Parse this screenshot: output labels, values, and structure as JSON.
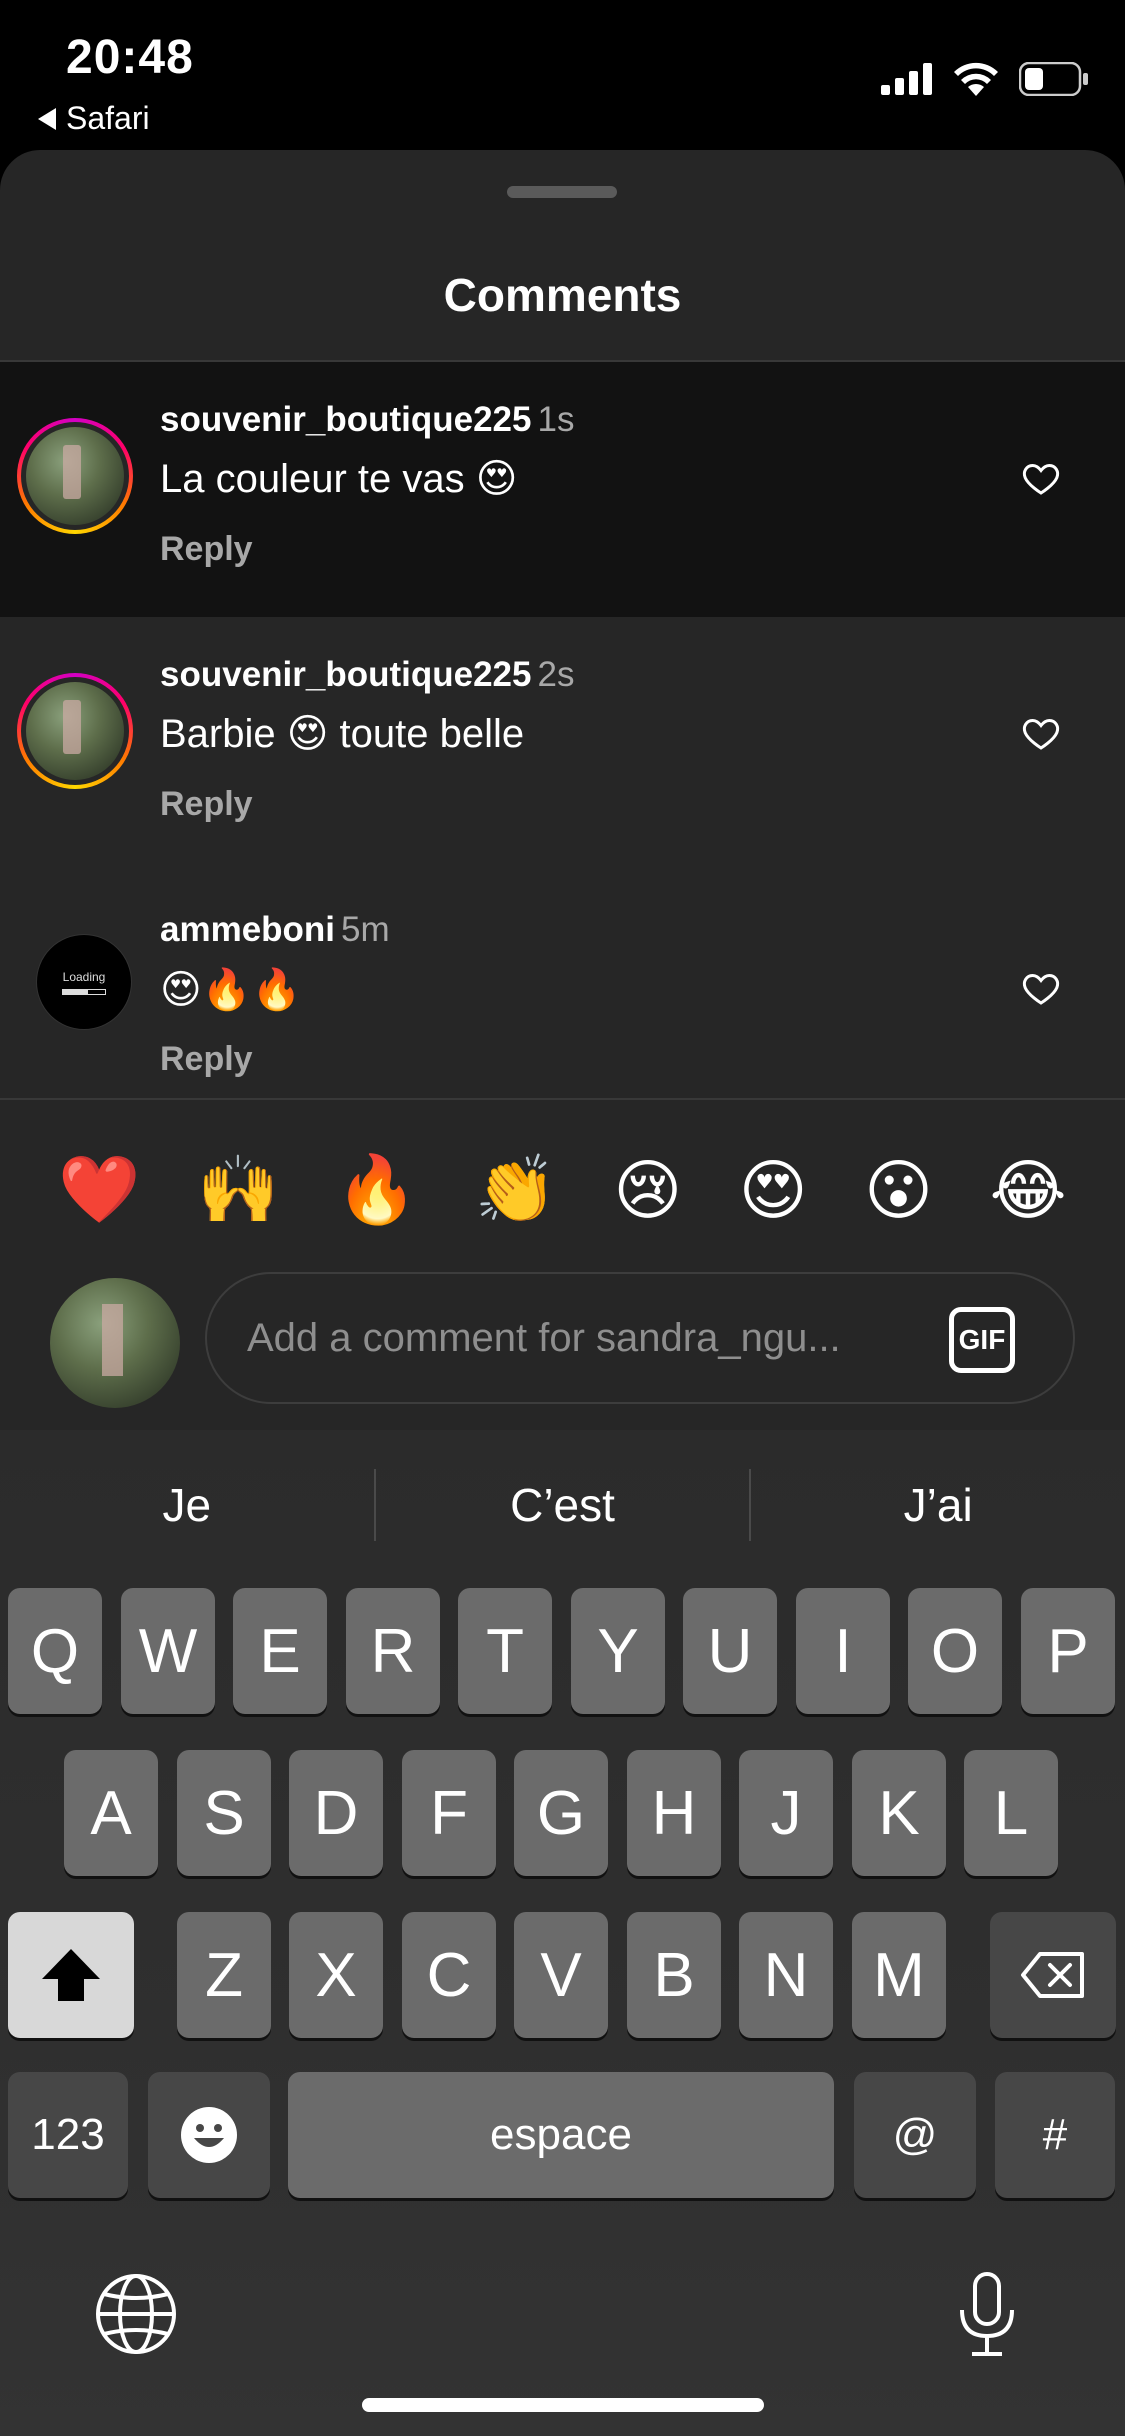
{
  "status_bar": {
    "time": "20:48",
    "back_label": "Safari"
  },
  "sheet": {
    "title": "Comments"
  },
  "comments": [
    {
      "user": "souvenir_boutique225",
      "time": "1s",
      "text": "La couleur te vas 😍",
      "reply": "Reply"
    },
    {
      "user": "souvenir_boutique225",
      "time": "2s",
      "text": "Barbie 😍 toute belle",
      "reply": "Reply"
    },
    {
      "user": "ammeboni",
      "time": "5m",
      "text": "😍🔥🔥",
      "reply": "Reply",
      "avatar_text": "Loading"
    }
  ],
  "emoji_bar": [
    "❤️",
    "🙌",
    "🔥",
    "👏",
    "😢",
    "😍",
    "😮",
    "😂"
  ],
  "composer": {
    "placeholder": "Add a comment for sandra_ngu...",
    "gif_label": "GIF"
  },
  "keyboard": {
    "suggestions": [
      "Je",
      "C’est",
      "J’ai"
    ],
    "row1": [
      "Q",
      "W",
      "E",
      "R",
      "T",
      "Y",
      "U",
      "I",
      "O",
      "P"
    ],
    "row2": [
      "A",
      "S",
      "D",
      "F",
      "G",
      "H",
      "J",
      "K",
      "L"
    ],
    "row3": [
      "Z",
      "X",
      "C",
      "V",
      "B",
      "N",
      "M"
    ],
    "numbers_label": "123",
    "space_label": "espace",
    "at_label": "@",
    "hash_label": "#"
  }
}
